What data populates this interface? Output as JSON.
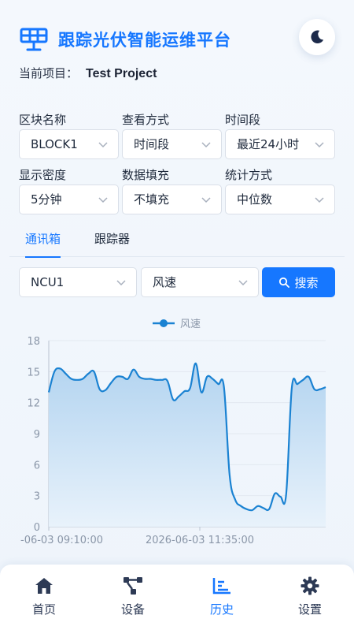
{
  "header": {
    "title": "跟踪光伏智能运维平台",
    "logo_icon": "solar-panel-icon",
    "theme_icon": "moon-icon"
  },
  "project": {
    "label": "当前项目：",
    "name": "Test Project"
  },
  "filters": {
    "row1": [
      {
        "label": "区块名称",
        "value": "BLOCK1"
      },
      {
        "label": "查看方式",
        "value": "时间段"
      },
      {
        "label": "时间段",
        "value": "最近24小时"
      }
    ],
    "row2": [
      {
        "label": "显示密度",
        "value": "5分钟"
      },
      {
        "label": "数据填充",
        "value": "不填充"
      },
      {
        "label": "统计方式",
        "value": "中位数"
      }
    ]
  },
  "tabs": [
    {
      "label": "通讯箱",
      "active": true
    },
    {
      "label": "跟踪器",
      "active": false
    }
  ],
  "query": {
    "device": "NCU1",
    "metric": "风速",
    "search_label": "搜索"
  },
  "colors": {
    "accent": "#1677ff",
    "line": "#1a82d2",
    "area_top": "#b3d4f0",
    "area_bottom": "#e8f2fb"
  },
  "chart_data": {
    "type": "area",
    "legend": [
      "风速"
    ],
    "legend_position": "top-center",
    "ylim": [
      0,
      18
    ],
    "yticks": [
      0,
      3,
      6,
      9,
      12,
      15,
      18
    ],
    "xtick_labels": [
      "-06-03 09:10:00",
      "2026-06-03 11:35:00"
    ],
    "series": [
      {
        "name": "风速",
        "values": [
          13.0,
          15.0,
          15.3,
          14.8,
          14.3,
          14.2,
          14.3,
          14.8,
          15.0,
          13.3,
          13.2,
          13.9,
          14.5,
          14.5,
          14.3,
          15.2,
          14.5,
          14.3,
          14.3,
          14.2,
          14.2,
          14.1,
          12.3,
          12.6,
          13.1,
          13.4,
          15.8,
          13.0,
          14.5,
          14.3,
          13.8,
          13.5,
          5.0,
          2.6,
          2.0,
          1.7,
          1.6,
          2.0,
          1.8,
          1.7,
          3.2,
          2.9,
          3.1,
          13.4,
          13.8,
          14.2,
          14.5,
          13.3,
          13.3,
          13.5
        ]
      }
    ]
  },
  "nav": [
    {
      "label": "首页",
      "icon": "home-icon",
      "active": false
    },
    {
      "label": "设备",
      "icon": "device-network-icon",
      "active": false
    },
    {
      "label": "历史",
      "icon": "history-chart-icon",
      "active": true
    },
    {
      "label": "设置",
      "icon": "settings-gear-icon",
      "active": false
    }
  ]
}
